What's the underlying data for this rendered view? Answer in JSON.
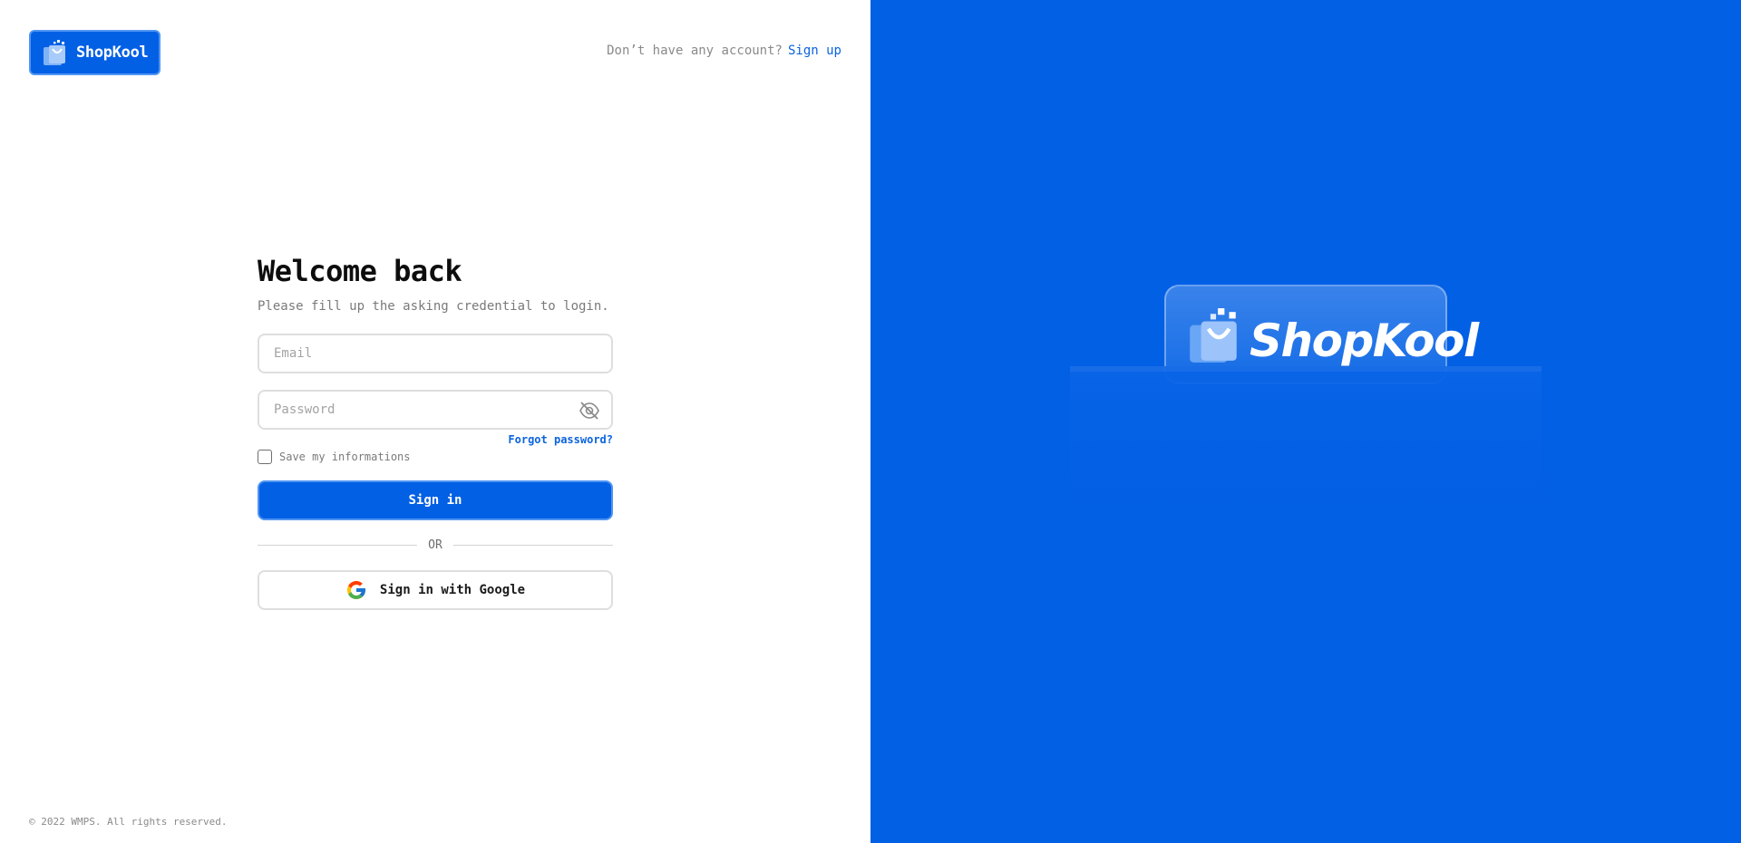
{
  "brand": {
    "name": "ShopKool",
    "icon": "shopping-bag-icon"
  },
  "header": {
    "signup_prompt": "Don’t have any account?",
    "signup_link": "Sign up"
  },
  "form": {
    "title": "Welcome back",
    "subtitle": "Please fill up the asking credential to login.",
    "email_placeholder": "Email",
    "email_value": "",
    "password_placeholder": "Password",
    "password_value": "",
    "password_toggle_icon": "eye-off-icon",
    "forgot_password": "Forgot password?",
    "remember_label": "Save my informations",
    "remember_checked": false,
    "signin_label": "Sign in",
    "divider_text": "OR",
    "google_label": "Sign in with Google",
    "google_icon": "google-icon"
  },
  "footer": {
    "copyright": "© 2022 WMPS. All rights reserved."
  },
  "hero": {
    "name": "ShopKool",
    "icon": "shopping-bag-icon"
  },
  "colors": {
    "primary": "#0260e5",
    "primary_border": "#4f95f3",
    "link": "#0b63de",
    "input_border": "#dedede",
    "muted_text": "#7a7a7a"
  }
}
